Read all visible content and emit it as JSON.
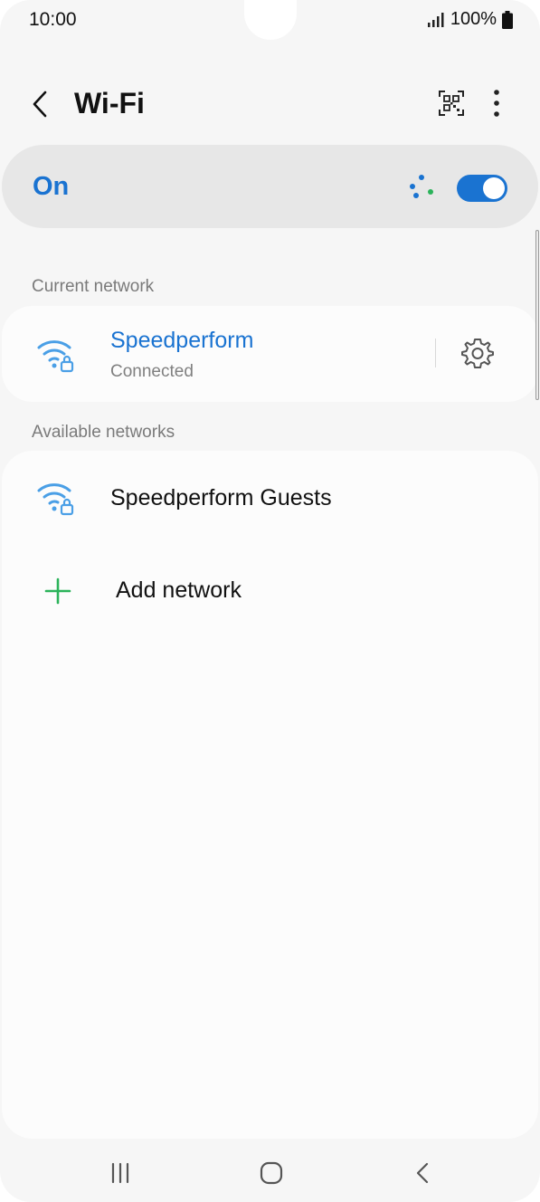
{
  "status_bar": {
    "time": "10:00",
    "battery": "100%"
  },
  "header": {
    "title": "Wi-Fi",
    "icons": [
      "back-icon",
      "qr-code-icon",
      "more-options-icon"
    ]
  },
  "master_switch": {
    "label": "On",
    "enabled": true
  },
  "current_section": {
    "label": "Current network",
    "network": {
      "name": "Speedperform",
      "status": "Connected",
      "secured": true
    }
  },
  "available_section": {
    "label": "Available networks",
    "networks": [
      {
        "name": "Speedperform Guests",
        "secured": true
      }
    ],
    "add_network_label": "Add network"
  },
  "colors": {
    "accent": "#1a73d1",
    "wifi_icon": "#4a9fe6",
    "add_icon": "#2bb35a",
    "scan_green": "#2bb35a"
  },
  "nav_bar": {
    "icons": [
      "recent-apps-icon",
      "home-icon",
      "back-nav-icon"
    ]
  }
}
